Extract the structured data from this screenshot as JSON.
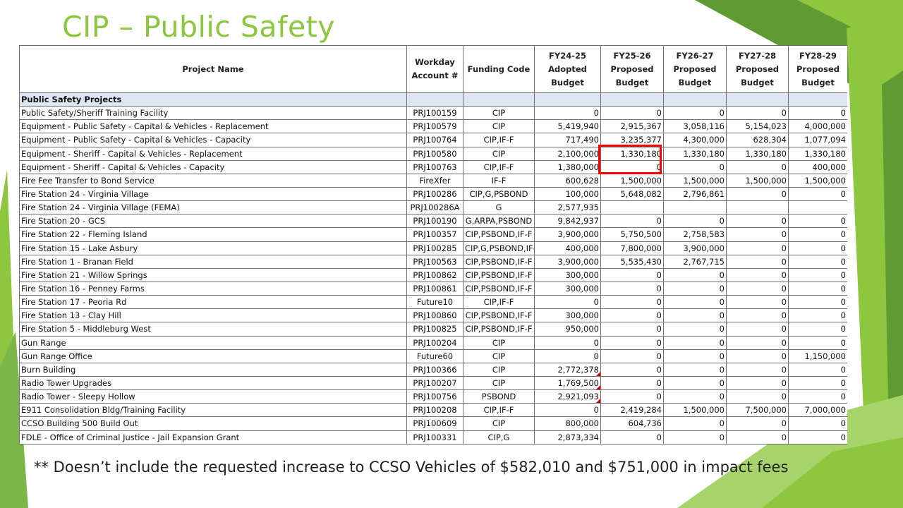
{
  "title": "CIP – Public Safety",
  "colors": {
    "title": "#8dc63f",
    "section_fill": "#dde6f2",
    "highlight": "#ff0000",
    "green_dark": "#5f9b32",
    "green_light": "#8dc63f"
  },
  "table": {
    "headers": [
      "Project Name",
      "Workday Account #",
      "Funding Code",
      "FY24-25 Adopted Budget",
      "FY25-26 Proposed Budget",
      "FY26-27 Proposed Budget",
      "FY27-28 Proposed Budget",
      "FY28-29 Proposed Budget"
    ],
    "section": "Public Safety Projects",
    "rows": [
      [
        "Public Safety/Sheriff Training Facility",
        "PRJ100159",
        "CIP",
        "0",
        "0",
        "0",
        "0",
        "0"
      ],
      [
        "Equipment - Public Safety - Capital & Vehicles - Replacement",
        "PRJ100579",
        "CIP",
        "5,419,940",
        "2,915,367",
        "3,058,116",
        "5,154,023",
        "4,000,000"
      ],
      [
        "Equipment - Public Safety - Capital & Vehicles - Capacity",
        "PRJ100764",
        "CIP,IF-F",
        "717,490",
        "3,235,377",
        "4,300,000",
        "628,304",
        "1,077,094"
      ],
      [
        "Equipment - Sheriff - Capital & Vehicles - Replacement",
        "PRJ100580",
        "CIP",
        "2,100,000",
        "1,330,180",
        "1,330,180",
        "1,330,180",
        "1,330,180"
      ],
      [
        "Equipment - Sheriff - Capital & Vehicles - Capacity",
        "PRJ100763",
        "CIP,IF-F",
        "1,380,000",
        "0",
        "0",
        "0",
        "400,000"
      ],
      [
        "Fire Fee Transfer to Bond Service",
        "FireXfer",
        "IF-F",
        "600,628",
        "1,500,000",
        "1,500,000",
        "1,500,000",
        "1,500,000"
      ],
      [
        "Fire Station 24 - Virginia Village",
        "PRJ100286",
        "CIP,G,PSBOND",
        "100,000",
        "5,648,082",
        "2,796,861",
        "0",
        "0"
      ],
      [
        "Fire Station 24 - Virginia Village (FEMA)",
        "PRJ100286A",
        "G",
        "2,577,935",
        "",
        "",
        "",
        ""
      ],
      [
        "Fire Station 20 - GCS",
        "PRJ100190",
        "G,ARPA,PSBOND",
        "9,842,937",
        "0",
        "0",
        "0",
        "0"
      ],
      [
        "Fire Station 22 - Fleming Island",
        "PRJ100357",
        "CIP,PSBOND,IF-F",
        "3,900,000",
        "5,750,500",
        "2,758,583",
        "0",
        "0"
      ],
      [
        "Fire Station 15 - Lake Asbury",
        "PRJ100285",
        "CIP,G,PSBOND,IF-",
        "400,000",
        "7,800,000",
        "3,900,000",
        "0",
        "0"
      ],
      [
        "Fire Station 1 - Branan Field",
        "PRJ100563",
        "CIP,PSBOND,IF-F",
        "3,900,000",
        "5,535,430",
        "2,767,715",
        "0",
        "0"
      ],
      [
        "Fire Station 21 - Willow Springs",
        "PRJ100862",
        "CIP,PSBOND,IF-F",
        "300,000",
        "0",
        "0",
        "0",
        "0"
      ],
      [
        "Fire Station 16 - Penney Farms",
        "PRJ100861",
        "CIP,PSBOND,IF-F",
        "300,000",
        "0",
        "0",
        "0",
        "0"
      ],
      [
        "Fire Station 17 - Peoria Rd",
        "Future10",
        "CIP,IF-F",
        "0",
        "0",
        "0",
        "0",
        "0"
      ],
      [
        "Fire Station 13 - Clay Hill",
        "PRJ100860",
        "CIP,PSBOND,IF-F",
        "300,000",
        "0",
        "0",
        "0",
        "0"
      ],
      [
        "Fire Station 5 - Middleburg West",
        "PRJ100825",
        "CIP,PSBOND,IF-F",
        "950,000",
        "0",
        "0",
        "0",
        "0"
      ],
      [
        "Gun Range",
        "PRJ100204",
        "CIP",
        "0",
        "0",
        "0",
        "0",
        "0"
      ],
      [
        "Gun Range Office",
        "Future60",
        "CIP",
        "0",
        "0",
        "0",
        "0",
        "1,150,000"
      ],
      [
        "Burn Building",
        "PRJ100366",
        "CIP",
        "2,772,378",
        "0",
        "0",
        "0",
        "0"
      ],
      [
        "Radio Tower Upgrades",
        "PRJ100207",
        "CIP",
        "1,769,500",
        "0",
        "0",
        "0",
        "0"
      ],
      [
        "Radio Tower - Sleepy Hollow",
        "PRJ100756",
        "PSBOND",
        "2,921,093",
        "0",
        "0",
        "0",
        "0"
      ],
      [
        "E911 Consolidation Bldg/Training Facility",
        "PRJ100208",
        "CIP,IF-F",
        "0",
        "2,419,284",
        "1,500,000",
        "7,500,000",
        "7,000,000"
      ],
      [
        "CCSO Building 500 Build Out",
        "PRJ100609",
        "CIP",
        "800,000",
        "604,736",
        "0",
        "0",
        "0"
      ],
      [
        "FDLE - Office of Criminal Justice - Jail Expansion Grant",
        "PRJ100331",
        "CIP,G",
        "2,873,334",
        "0",
        "0",
        "0",
        "0"
      ]
    ]
  },
  "footnote": "** Doesn’t include the requested increase to CCSO Vehicles of $582,010 and $751,000 in impact fees"
}
